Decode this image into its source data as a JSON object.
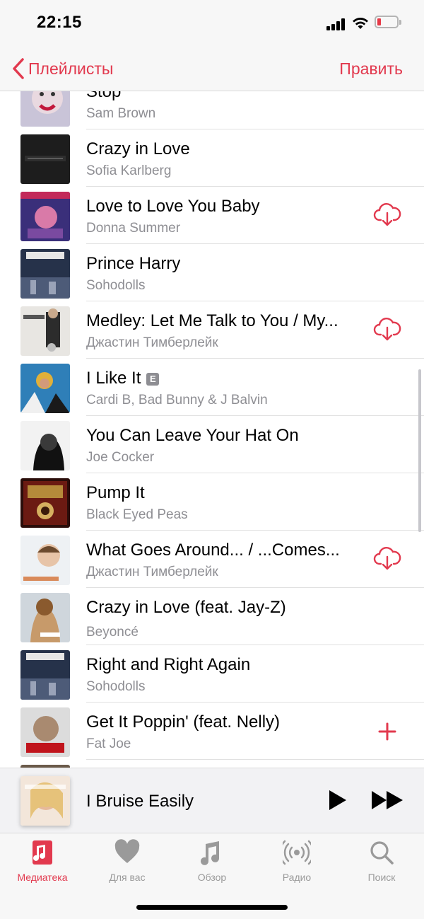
{
  "status_bar": {
    "time": "22:15",
    "battery_color": "#e63946"
  },
  "nav": {
    "back_label": "Плейлисты",
    "edit_label": "Править"
  },
  "accent_color": "#e2394e",
  "songs": [
    {
      "title": "Stop",
      "artist": "Sam Brown",
      "action": "none",
      "explicit": false
    },
    {
      "title": "Crazy in Love",
      "artist": "Sofia Karlberg",
      "action": "none",
      "explicit": false
    },
    {
      "title": "Love to Love You Baby",
      "artist": "Donna Summer",
      "action": "download",
      "explicit": false
    },
    {
      "title": "Prince Harry",
      "artist": "Sohodolls",
      "action": "none",
      "explicit": false
    },
    {
      "title": "Medley: Let Me Talk to You / My...",
      "artist": "Джастин Тимберлейк",
      "action": "download",
      "explicit": false
    },
    {
      "title": "I Like It",
      "artist": "Cardi B, Bad Bunny & J Balvin",
      "action": "none",
      "explicit": true,
      "explicit_badge": "E"
    },
    {
      "title": "You Can Leave Your Hat On",
      "artist": "Joe Cocker",
      "action": "none",
      "explicit": false
    },
    {
      "title": "Pump It",
      "artist": "Black Eyed Peas",
      "action": "none",
      "explicit": false
    },
    {
      "title": "What Goes Around... / ...Comes...",
      "artist": "Джастин Тимберлейк",
      "action": "download",
      "explicit": false
    },
    {
      "title": "Crazy in Love (feat. Jay-Z)",
      "artist": "Beyoncé",
      "action": "none",
      "explicit": false
    },
    {
      "title": "Right and Right Again",
      "artist": "Sohodolls",
      "action": "none",
      "explicit": false
    },
    {
      "title": "Get It Poppin' (feat. Nelly)",
      "artist": "Fat Joe",
      "action": "add",
      "explicit": false
    }
  ],
  "mini_player": {
    "title": "I Bruise Easily"
  },
  "tabs": [
    {
      "label": "Медиатека",
      "icon": "library-icon",
      "active": true
    },
    {
      "label": "Для вас",
      "icon": "heart-icon",
      "active": false
    },
    {
      "label": "Обзор",
      "icon": "music-note-icon",
      "active": false
    },
    {
      "label": "Радио",
      "icon": "radio-icon",
      "active": false
    },
    {
      "label": "Поиск",
      "icon": "search-icon",
      "active": false
    }
  ]
}
